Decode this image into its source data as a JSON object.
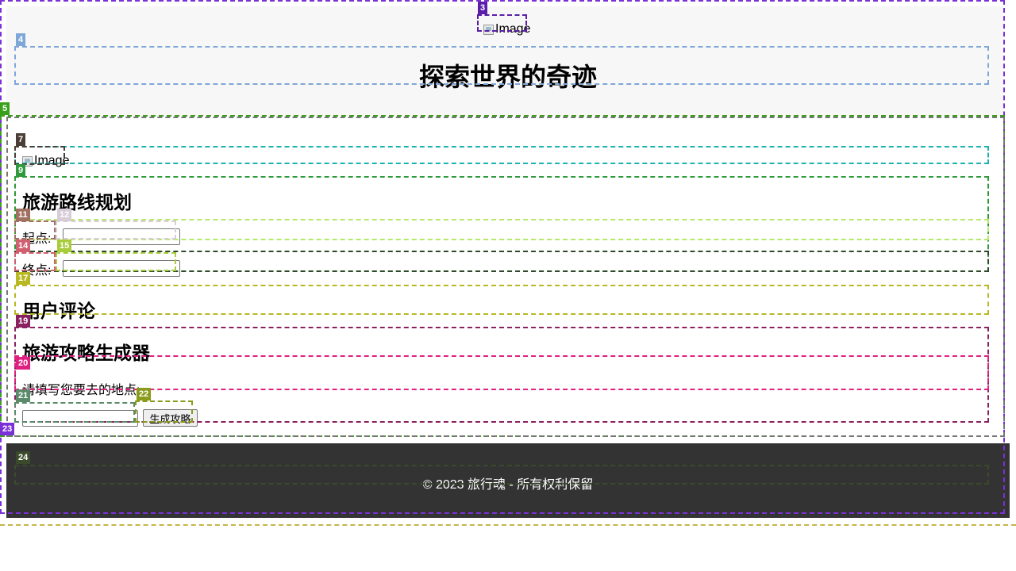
{
  "header": {
    "logo_alt": "Image",
    "title": "探索世界的奇迹"
  },
  "main": {
    "banner_alt": "Image",
    "route_planner": {
      "title": "旅游路线规划",
      "start_label": "起点:",
      "start_value": "",
      "end_label": "终点:",
      "end_value": ""
    },
    "reviews": {
      "title": "用户评论"
    },
    "guide_generator": {
      "title": "旅游攻略生成器",
      "prompt": "请填写您要去的地点:",
      "location_value": "",
      "generate_button": "生成攻略"
    }
  },
  "footer": {
    "copyright": "© 2023 旅行魂 - 所有权利保留"
  },
  "overlay_tags": [
    "3",
    "4",
    "5",
    "7",
    "9",
    "11",
    "12",
    "14",
    "15",
    "17",
    "19",
    "20",
    "21",
    "22",
    "23",
    "24"
  ]
}
